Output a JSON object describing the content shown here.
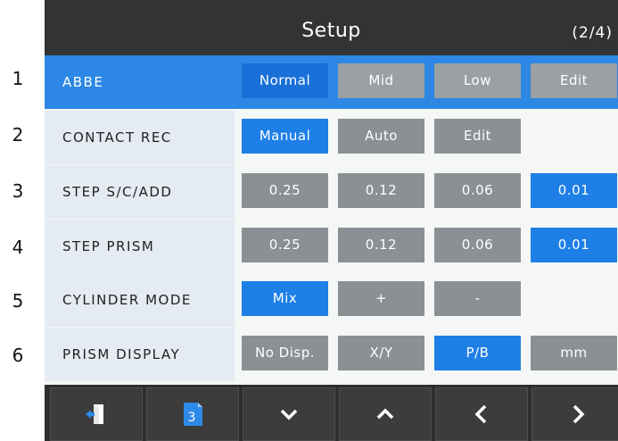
{
  "header": {
    "title": "Setup",
    "page": "(2/4)"
  },
  "row_numbers": [
    "1",
    "2",
    "3",
    "4",
    "5",
    "6"
  ],
  "rows": [
    {
      "label": "ABBE",
      "selected": true,
      "options": [
        {
          "label": "Normal",
          "active": true
        },
        {
          "label": "Mid",
          "active": false
        },
        {
          "label": "Low",
          "active": false
        },
        {
          "label": "Edit",
          "active": false
        }
      ]
    },
    {
      "label": "CONTACT REC",
      "selected": false,
      "options": [
        {
          "label": "Manual",
          "active": true
        },
        {
          "label": "Auto",
          "active": false
        },
        {
          "label": "Edit",
          "active": false
        }
      ]
    },
    {
      "label": "STEP S/C/ADD",
      "selected": false,
      "options": [
        {
          "label": "0.25",
          "active": false
        },
        {
          "label": "0.12",
          "active": false
        },
        {
          "label": "0.06",
          "active": false
        },
        {
          "label": "0.01",
          "active": true
        }
      ]
    },
    {
      "label": "STEP PRISM",
      "selected": false,
      "options": [
        {
          "label": "0.25",
          "active": false
        },
        {
          "label": "0.12",
          "active": false
        },
        {
          "label": "0.06",
          "active": false
        },
        {
          "label": "0.01",
          "active": true
        }
      ]
    },
    {
      "label": "CYLINDER MODE",
      "selected": false,
      "options": [
        {
          "label": "Mix",
          "active": true
        },
        {
          "label": "+",
          "active": false
        },
        {
          "label": "-",
          "active": false
        }
      ]
    },
    {
      "label": "PRISM DISPLAY",
      "selected": false,
      "options": [
        {
          "label": "No Disp.",
          "active": false
        },
        {
          "label": "X/Y",
          "active": false
        },
        {
          "label": "P/B",
          "active": true
        },
        {
          "label": "mm",
          "active": false
        }
      ]
    }
  ],
  "toolbar": {
    "buttons": [
      {
        "icon": "exit-door-icon"
      },
      {
        "icon": "page-icon",
        "badge": "3"
      },
      {
        "icon": "chevron-down-icon"
      },
      {
        "icon": "chevron-up-icon"
      },
      {
        "icon": "chevron-left-icon"
      },
      {
        "icon": "chevron-right-icon"
      }
    ]
  },
  "colors": {
    "accent": "#1e7fe6",
    "selected_row": "#2d87e4",
    "header": "#333333",
    "button_inactive": "#8a9093"
  }
}
